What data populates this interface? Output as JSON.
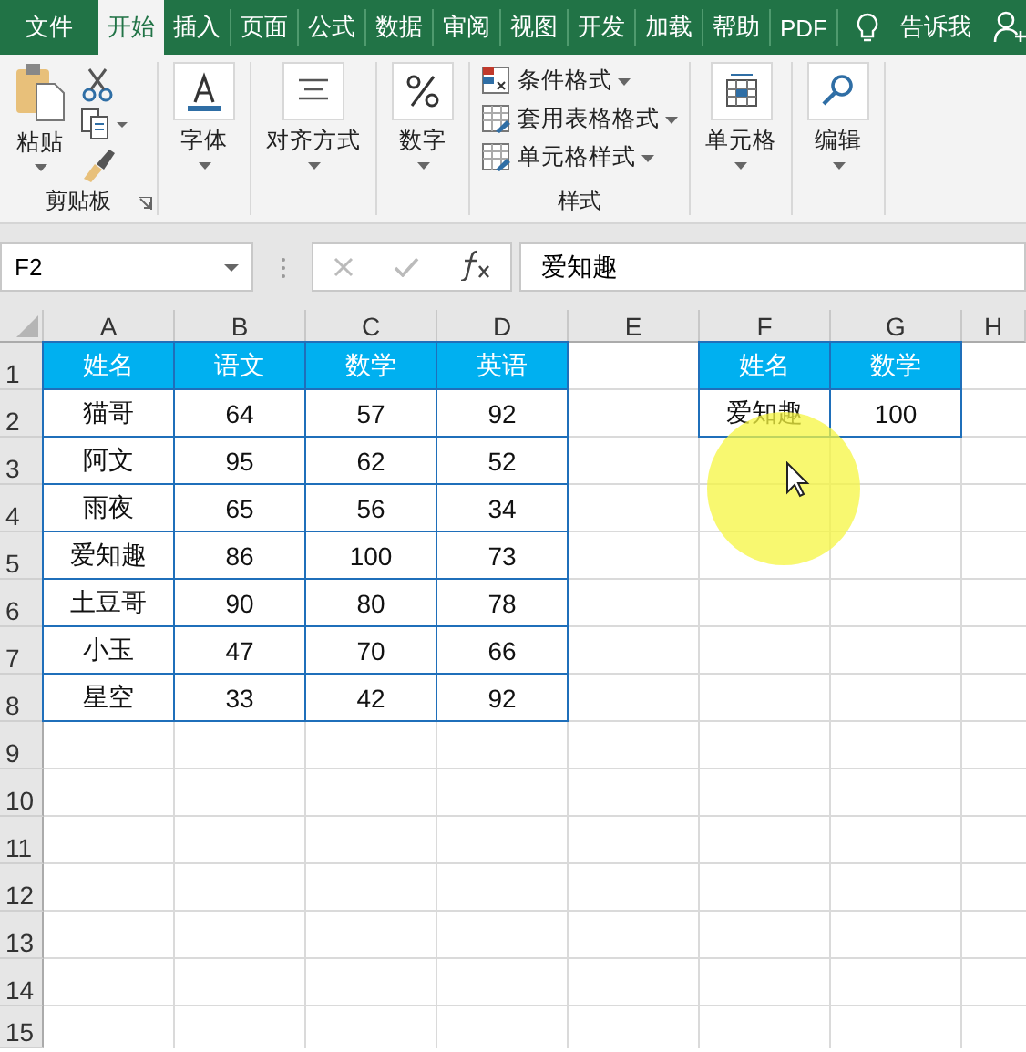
{
  "tabs": [
    {
      "label": "文件",
      "selected": false,
      "kind": "file"
    },
    {
      "label": "开始",
      "selected": true,
      "kind": "tab"
    },
    {
      "label": "插入",
      "selected": false,
      "kind": "tab"
    },
    {
      "label": "页面",
      "selected": false,
      "kind": "tab"
    },
    {
      "label": "公式",
      "selected": false,
      "kind": "tab"
    },
    {
      "label": "数据",
      "selected": false,
      "kind": "tab"
    },
    {
      "label": "审阅",
      "selected": false,
      "kind": "tab"
    },
    {
      "label": "视图",
      "selected": false,
      "kind": "tab"
    },
    {
      "label": "开发",
      "selected": false,
      "kind": "tab"
    },
    {
      "label": "加载",
      "selected": false,
      "kind": "tab"
    },
    {
      "label": "帮助",
      "selected": false,
      "kind": "tab"
    },
    {
      "label": "PDF",
      "selected": false,
      "kind": "tab"
    }
  ],
  "tell_me": "告诉我",
  "ribbon": {
    "paste": "粘贴",
    "clipboard_label": "剪贴板",
    "big_buttons": [
      {
        "label": "字体",
        "kind": "font"
      },
      {
        "label": "对齐方式",
        "kind": "align"
      },
      {
        "label": "数字",
        "kind": "number"
      }
    ],
    "styles": {
      "items": [
        {
          "label": "条件格式",
          "kind": "conditional"
        },
        {
          "label": "套用表格格式",
          "kind": "table"
        },
        {
          "label": "单元格样式",
          "kind": "cellstyle"
        }
      ],
      "label": "样式"
    },
    "end_buttons": [
      {
        "label": "单元格",
        "kind": "cells"
      },
      {
        "label": "编辑",
        "kind": "edit"
      }
    ]
  },
  "formula_bar": {
    "name_box": "F2",
    "formula": "爱知趣"
  },
  "sheet": {
    "columns": [
      "A",
      "B",
      "C",
      "D",
      "E",
      "F",
      "G",
      "H"
    ],
    "rows": [
      "1",
      "2",
      "3",
      "4",
      "5",
      "6",
      "7",
      "8",
      "9",
      "10",
      "11",
      "12",
      "13",
      "14",
      "15"
    ],
    "tables": [
      {
        "header": [
          "姓名",
          "语文",
          "数学",
          "英语"
        ],
        "rows": [
          [
            "猫哥",
            "64",
            "57",
            "92"
          ],
          [
            "阿文",
            "95",
            "62",
            "52"
          ],
          [
            "雨夜",
            "65",
            "56",
            "34"
          ],
          [
            "爱知趣",
            "86",
            "100",
            "73"
          ],
          [
            "土豆哥",
            "90",
            "80",
            "78"
          ],
          [
            "小玉",
            "47",
            "70",
            "66"
          ],
          [
            "星空",
            "33",
            "42",
            "92"
          ]
        ]
      },
      {
        "header": [
          "姓名",
          "数学"
        ],
        "rows": [
          [
            "爱知趣",
            "100"
          ]
        ]
      }
    ]
  }
}
